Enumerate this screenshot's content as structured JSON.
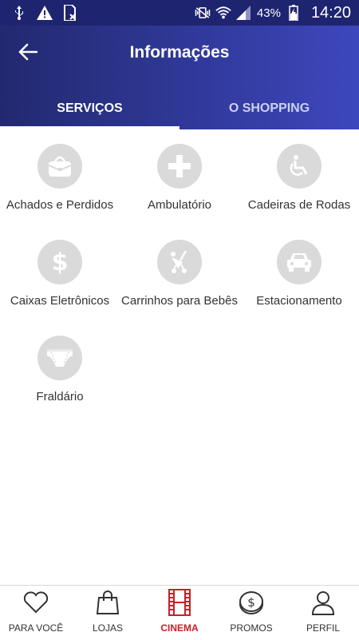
{
  "status_bar": {
    "icons": [
      "usb-icon",
      "warning-icon",
      "no-sim-icon",
      "vibrate-icon",
      "wifi-icon",
      "signal-icon",
      "battery-charging-icon"
    ],
    "battery": "43%",
    "time": "14:20"
  },
  "header": {
    "back_icon": "arrow-left-icon",
    "title": "Informações"
  },
  "tabs": [
    {
      "label": "SERVIÇOS",
      "active": true
    },
    {
      "label": "O SHOPPING",
      "active": false
    }
  ],
  "services": [
    {
      "label": "Achados e Perdidos",
      "icon": "bag-icon"
    },
    {
      "label": "Ambulatório",
      "icon": "plus-icon"
    },
    {
      "label": "Cadeiras de Rodas",
      "icon": "wheelchair-icon"
    },
    {
      "label": "Caixas Eletrônicos",
      "icon": "dollar-icon"
    },
    {
      "label": "Carrinhos para Bebês",
      "icon": "stroller-icon"
    },
    {
      "label": "Estacionamento",
      "icon": "car-icon"
    },
    {
      "label": "Fraldário",
      "icon": "diaper-icon"
    }
  ],
  "bottom_nav": [
    {
      "label": "PARA VOCÊ",
      "icon": "heart-icon",
      "active": false
    },
    {
      "label": "LOJAS",
      "icon": "shopping-bag-icon",
      "active": false
    },
    {
      "label": "CINEMA",
      "icon": "film-icon",
      "active": true
    },
    {
      "label": "PROMOS",
      "icon": "coin-icon",
      "active": false
    },
    {
      "label": "PERFIL",
      "icon": "user-icon",
      "active": false
    }
  ],
  "colors": {
    "header_start": "#22296f",
    "header_end": "#3d47bd",
    "icon_circle": "#dadada",
    "active_nav": "#c8202a"
  }
}
